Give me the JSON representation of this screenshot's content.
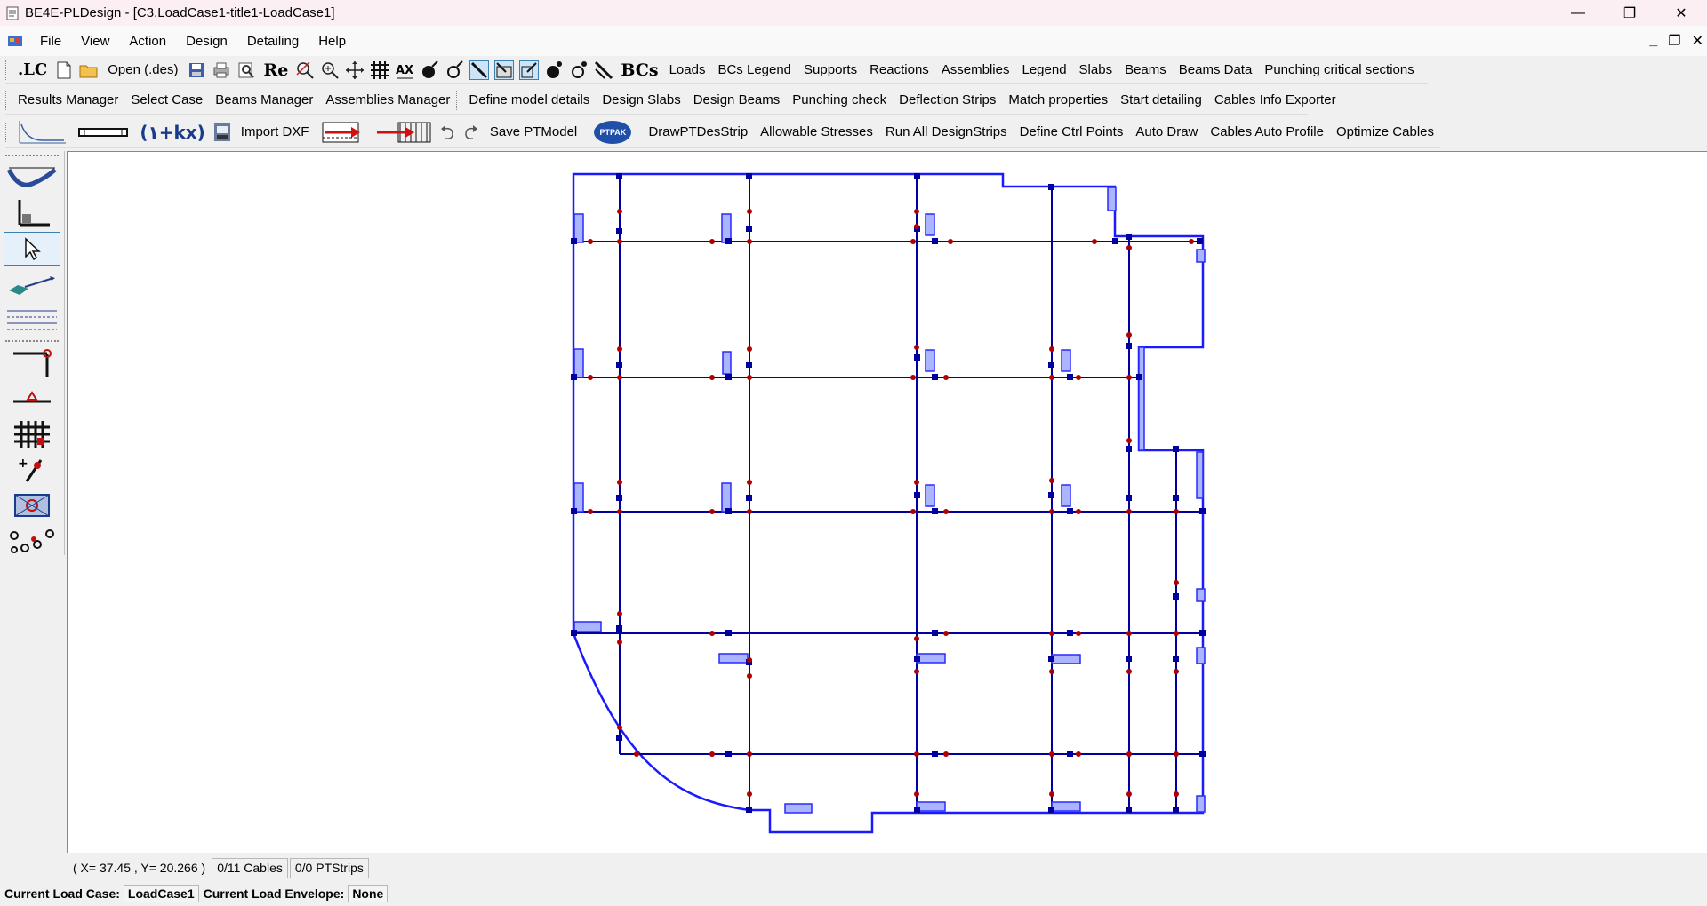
{
  "window": {
    "title": "BE4E-PLDesign - [C3.LoadCase1-title1-LoadCase1]",
    "minimize": "—",
    "restore": "❐",
    "close": "✕"
  },
  "menu": {
    "items": [
      "File",
      "View",
      "Action",
      "Design",
      "Detailing",
      "Help"
    ],
    "mdi_minimize": "_",
    "mdi_restore": "❐",
    "mdi_close": "✕"
  },
  "toolbar1": {
    "lc": ".LC",
    "open": "Open (.des)",
    "re": "Re",
    "bcs": "BCs",
    "buttons": [
      "Loads",
      "BCs Legend",
      "Supports",
      "Reactions",
      "Assemblies",
      "Legend",
      "Slabs",
      "Beams",
      "Beams Data",
      "Punching critical sections"
    ]
  },
  "toolbar2": {
    "buttons": [
      "Results Manager",
      "Select Case",
      "Beams Manager",
      "Assemblies Manager",
      "Define model details",
      "Design Slabs",
      "Design Beams",
      "Punching check",
      "Deflection Strips",
      "Match properties",
      "Start detailing",
      "Cables Info Exporter"
    ]
  },
  "toolbar3": {
    "formula": "(١+kx)",
    "import_dxf": "Import DXF",
    "save_ptmodel": "Save PTModel",
    "ptpak": "PTPAK",
    "buttons": [
      "DrawPTDesStrip",
      "Allowable Stresses",
      "Run All DesignStrips",
      "Define Ctrl Points",
      "Auto Draw",
      "Cables Auto Profile",
      "Optimize Cables"
    ]
  },
  "toolbox": {
    "icons": [
      "cable-profile-icon",
      "axis-corner-icon",
      "pointer-icon",
      "slab-beam-icon",
      "strip-lines-icon",
      "column-support-icon",
      "load-point-icon",
      "mesh-grid-icon",
      "add-point-icon",
      "box-marker-icon",
      "nodes-icon"
    ]
  },
  "status": {
    "coord": "( X= 37.45 , Y= 20.266 )",
    "cables": "0/11 Cables",
    "ptstrips": "0/0 PTStrips",
    "load_case_label": "Current Load Case:",
    "load_case": "LoadCase1",
    "load_env_label": "Current Load Envelope:",
    "load_env": "None"
  },
  "colors": {
    "outline": "#1a1aff",
    "beam": "#0000a0",
    "node": "#b00000",
    "column_fill": "#aab4ff",
    "column_stroke": "#2a2aff"
  }
}
